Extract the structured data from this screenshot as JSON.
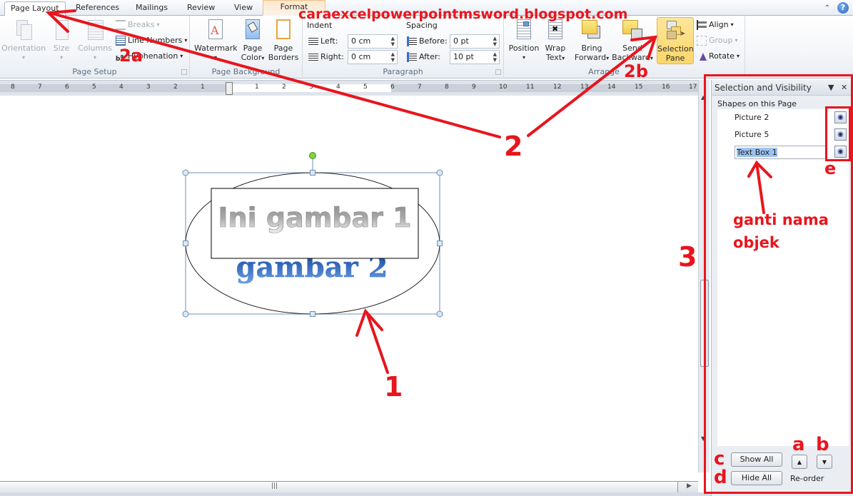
{
  "tabs": [
    {
      "label": "Page Layout",
      "active": true
    },
    {
      "label": "References"
    },
    {
      "label": "Mailings"
    },
    {
      "label": "Review"
    },
    {
      "label": "View"
    },
    {
      "label": "Format",
      "contextual": true
    }
  ],
  "watermark_url": "caraexcelpowerpointmsword.blogspot.com",
  "ribbon": {
    "page_setup": {
      "label": "Page Setup",
      "orientation": "Orientation",
      "size": "Size",
      "columns": "Columns",
      "breaks": "Breaks",
      "line_numbers": "Line Numbers",
      "hyphenation": "Hyphenation"
    },
    "page_background": {
      "label": "Page Background",
      "watermark": "Watermark",
      "page_color_1": "Page",
      "page_color_2": "Color",
      "page_borders_1": "Page",
      "page_borders_2": "Borders"
    },
    "paragraph": {
      "label": "Paragraph",
      "indent_label": "Indent",
      "spacing_label": "Spacing",
      "left_label": "Left:",
      "left_value": "0 cm",
      "right_label": "Right:",
      "right_value": "0 cm",
      "before_label": "Before:",
      "before_value": "0 pt",
      "after_label": "After:",
      "after_value": "10 pt"
    },
    "arrange": {
      "label": "Arrange",
      "position": "Position",
      "wrap_1": "Wrap",
      "wrap_2": "Text",
      "bring_1": "Bring",
      "bring_2": "Forward",
      "send_1": "Send",
      "send_2": "Backward",
      "selpane_1": "Selection",
      "selpane_2": "Pane",
      "align": "Align",
      "group": "Group",
      "rotate": "Rotate"
    }
  },
  "ruler": {
    "left_numbers": [
      "8",
      "7",
      "6",
      "5",
      "4",
      "3",
      "2",
      "1"
    ],
    "right_numbers": [
      "1",
      "2",
      "3",
      "4",
      "5",
      "6",
      "7",
      "8",
      "9",
      "10",
      "11",
      "12",
      "13",
      "14",
      "15",
      "16",
      "17"
    ]
  },
  "document": {
    "textbox_text": "Ini gambar 1",
    "wordart_text": "gambar 2"
  },
  "selection_pane": {
    "title": "Selection and Visibility",
    "shapes_label": "Shapes on this Page",
    "shapes": [
      {
        "name": "Picture 2",
        "visible": true
      },
      {
        "name": "Picture 5",
        "visible": true
      },
      {
        "name": "Text Box 1",
        "visible": true,
        "editing": true
      }
    ],
    "show_all": "Show All",
    "hide_all": "Hide All",
    "reorder_label": "Re-order"
  },
  "annotations": {
    "n1": "1",
    "n2": "2",
    "n2a": "2a",
    "n2b": "2b",
    "n3": "3",
    "a": "a",
    "b": "b",
    "c": "c",
    "d": "d",
    "e": "e",
    "rename_1": "ganti nama",
    "rename_2": "objek"
  },
  "colors": {
    "annotation_red": "#e8151d",
    "selection_highlight": "#9cc2f0",
    "active_button": "#fcd66a"
  }
}
